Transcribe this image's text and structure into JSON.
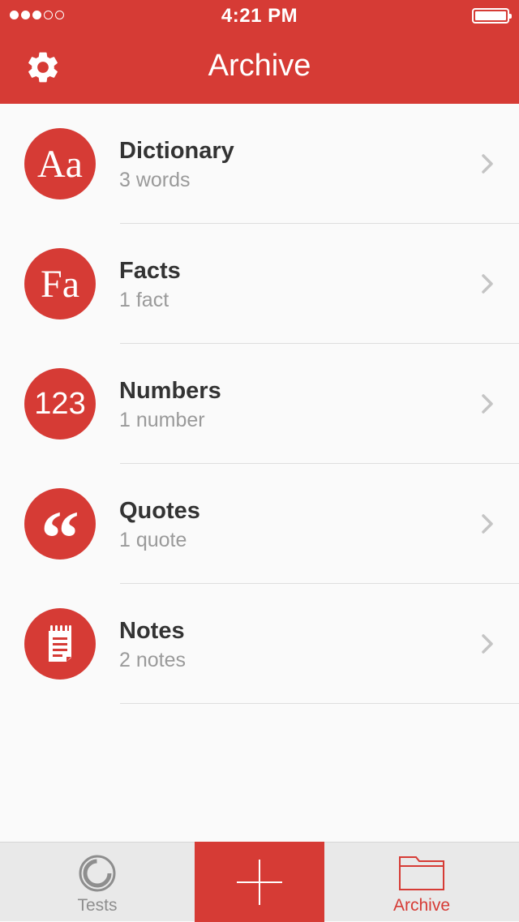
{
  "status_bar": {
    "time": "4:21 PM",
    "signal_dots_filled": 3,
    "signal_dots_total": 5
  },
  "header": {
    "title": "Archive",
    "settings_icon": "gear-icon"
  },
  "colors": {
    "accent": "#d63b35",
    "subtitle": "#9a9a9a",
    "title_text": "#333333"
  },
  "items": [
    {
      "title": "Dictionary",
      "subtitle": "3 words",
      "badge": "Aa",
      "icon": "dictionary-icon"
    },
    {
      "title": "Facts",
      "subtitle": "1 fact",
      "badge": "Fa",
      "icon": "facts-icon"
    },
    {
      "title": "Numbers",
      "subtitle": "1 number",
      "badge": "123",
      "icon": "numbers-icon"
    },
    {
      "title": "Quotes",
      "subtitle": "1 quote",
      "badge": "“",
      "icon": "quote-icon"
    },
    {
      "title": "Notes",
      "subtitle": "2 notes",
      "badge": "",
      "icon": "notepad-icon"
    }
  ],
  "tabbar": {
    "tests_label": "Tests",
    "add_icon": "plus-icon",
    "archive_label": "Archive",
    "selected": "Archive"
  }
}
